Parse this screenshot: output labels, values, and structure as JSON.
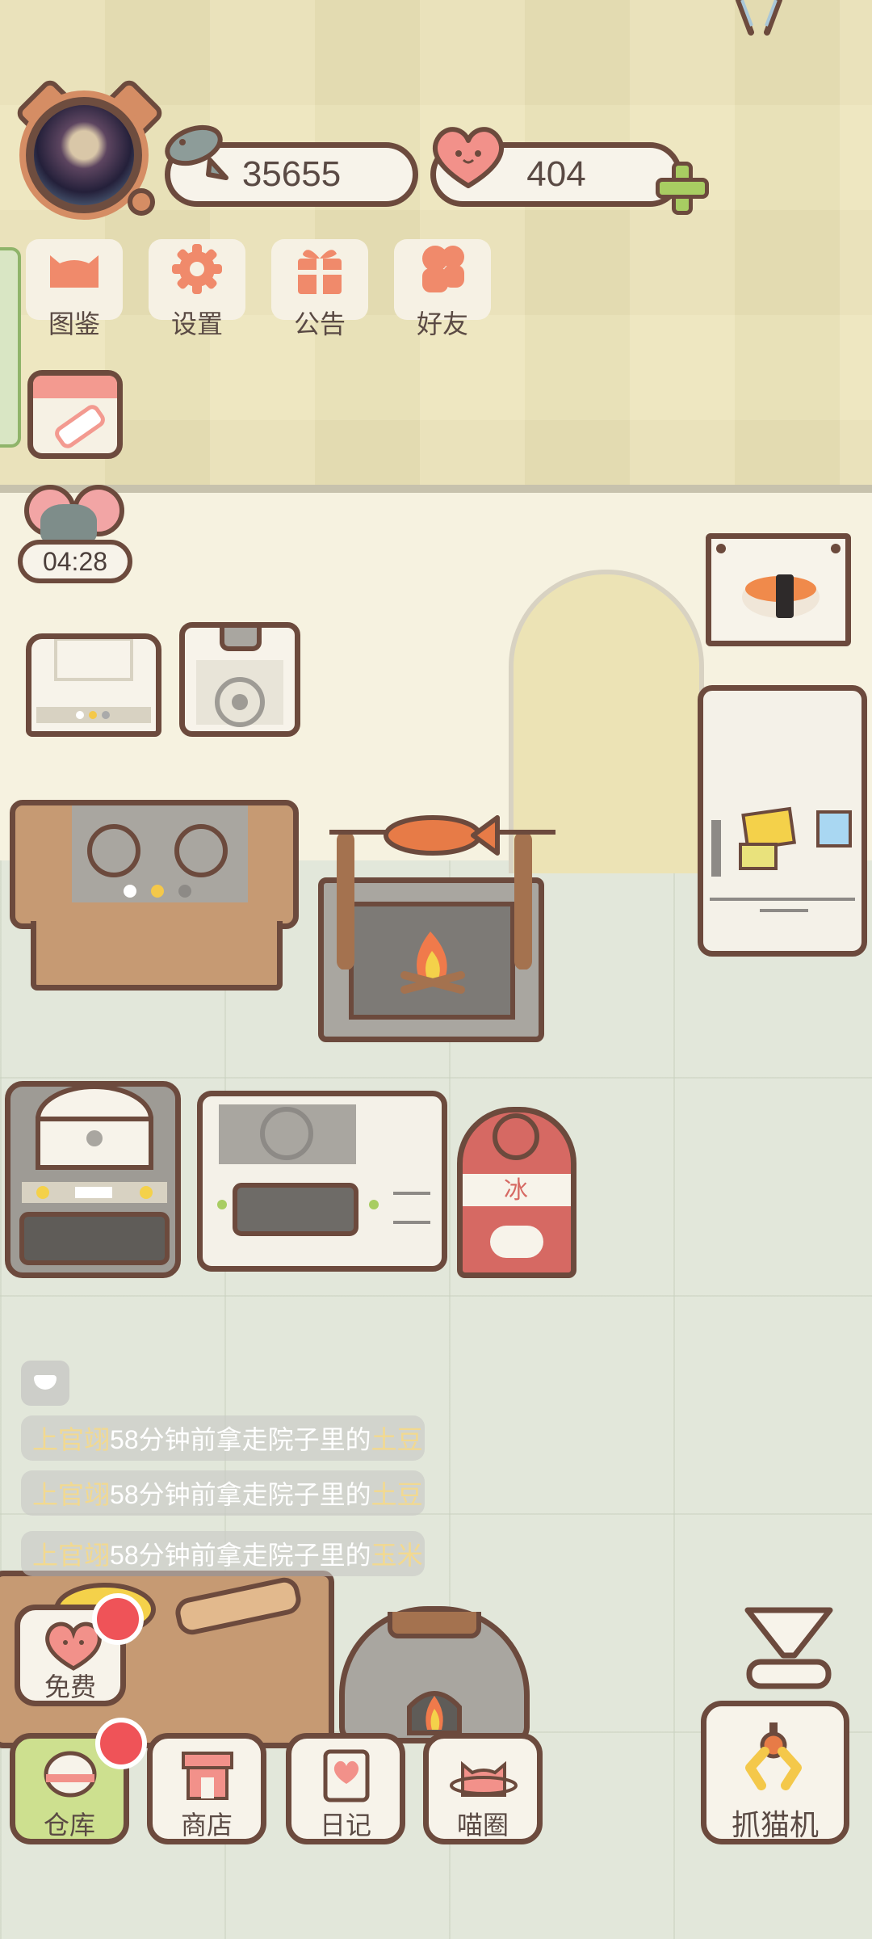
{
  "hud": {
    "fish_coins": "35655",
    "hearts": "404",
    "timer": "04:28"
  },
  "menu": [
    {
      "label": "图鉴",
      "icon": "cat-head-icon"
    },
    {
      "label": "设置",
      "icon": "gear-icon"
    },
    {
      "label": "公告",
      "icon": "gift-icon"
    },
    {
      "label": "好友",
      "icon": "friends-icon"
    }
  ],
  "feed": [
    {
      "name": "上官翊",
      "text": "58分钟前拿走院子里的",
      "item": "土豆"
    },
    {
      "name": "上官翊",
      "text": "58分钟前拿走院子里的",
      "item": "土豆"
    },
    {
      "name": "上官翊",
      "text": "58分钟前拿走院子里的",
      "item": "玉米"
    }
  ],
  "free_label": "免费",
  "nav": [
    {
      "label": "仓库",
      "icon": "rice-bowl-icon"
    },
    {
      "label": "商店",
      "icon": "shop-icon"
    },
    {
      "label": "日记",
      "icon": "diary-icon"
    },
    {
      "label": "喵圈",
      "icon": "cat-planet-icon"
    }
  ],
  "claw_label": "抓猫机",
  "colors": {
    "accent_red": "#ef5358",
    "outline": "#6c4a3d",
    "nav_active": "#cde08f"
  }
}
